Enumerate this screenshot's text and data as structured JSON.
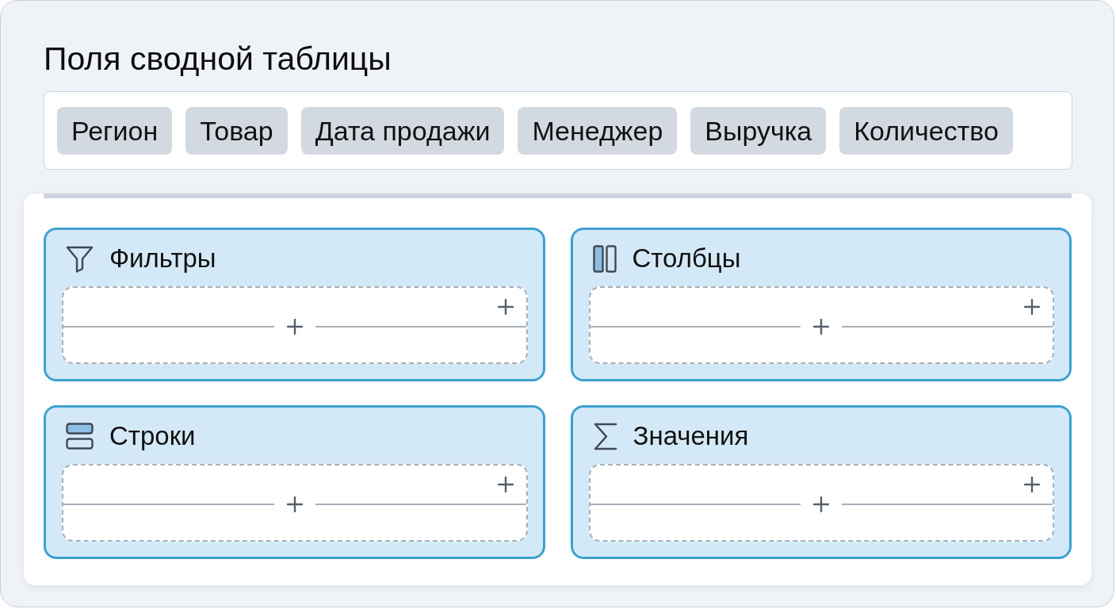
{
  "panel": {
    "title": "Поля сводной таблицы"
  },
  "fields": [
    {
      "label": "Регион"
    },
    {
      "label": "Товар"
    },
    {
      "label": "Дата продажи"
    },
    {
      "label": "Менеджер"
    },
    {
      "label": "Выручка"
    },
    {
      "label": "Количество"
    }
  ],
  "areas": [
    {
      "kind": "filters",
      "label": "Фильтры"
    },
    {
      "kind": "columns",
      "label": "Столбцы"
    },
    {
      "kind": "rows",
      "label": "Строки"
    },
    {
      "kind": "values",
      "label": "Значения"
    }
  ]
}
